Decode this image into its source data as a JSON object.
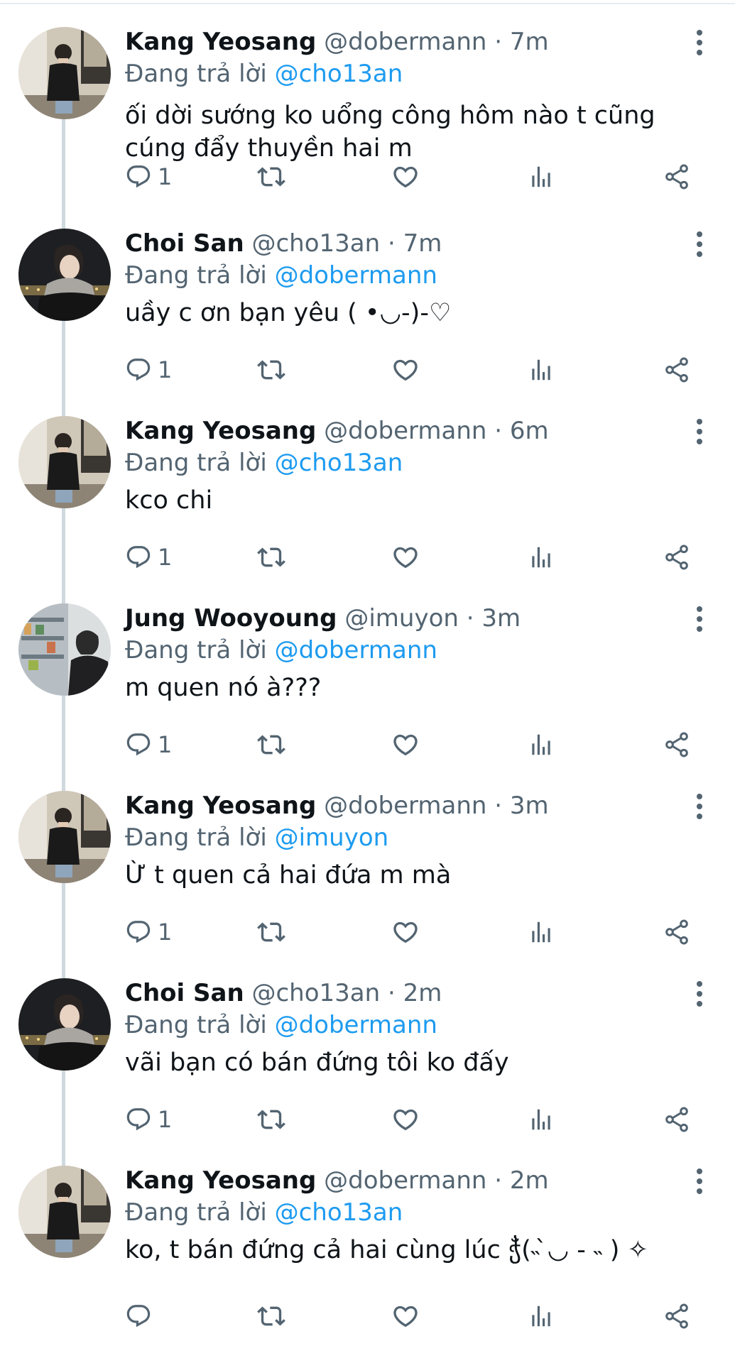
{
  "reply_prefix": "Đang trả lời",
  "colors": {
    "accent": "#1d9bf0",
    "secondary": "#536471",
    "text": "#0f1419",
    "thread_line": "#cfd9de"
  },
  "tweets": [
    {
      "name": "Kang Yeosang",
      "meta": "@dobermann · 7m",
      "reply_to": "@cho13an",
      "text": "ối dời sướng ko uổng công hôm nào t cũng cúng đẩy thuyền hai m",
      "reply_count": "1",
      "avatar": "avatar-yeosang"
    },
    {
      "name": "Choi San",
      "meta": "@cho13an · 7m",
      "reply_to": "@dobermann",
      "text": "uầy c ơn bạn yêu ( •◡-)-♡",
      "reply_count": "1",
      "avatar": "avatar-san"
    },
    {
      "name": "Kang Yeosang",
      "meta": "@dobermann · 6m",
      "reply_to": "@cho13an",
      "text": "kco chi",
      "reply_count": "1",
      "avatar": "avatar-yeosang"
    },
    {
      "name": "Jung Wooyoung",
      "meta": "@imuyon · 3m",
      "reply_to": "@dobermann",
      "text": "m quen nó à???",
      "reply_count": "1",
      "avatar": "avatar-wooyoung"
    },
    {
      "name": "Kang Yeosang",
      "meta": "@dobermann · 3m",
      "reply_to": "@imuyon",
      "text": "Ừ t quen cả hai đứa m mà",
      "reply_count": "1",
      "avatar": "avatar-yeosang"
    },
    {
      "name": "Choi San",
      "meta": "@cho13an · 2m",
      "reply_to": "@dobermann",
      "text": "vãi bạn có bán đứng tôi ko đấy",
      "reply_count": "1",
      "avatar": "avatar-san"
    },
    {
      "name": "Kang Yeosang",
      "meta": "@dobermann · 2m",
      "reply_to": "@cho13an",
      "text": "ko, t bán đứng cả hai cùng lúc ჭ̐(˵ ̀◡ - ˵ ) ✧",
      "reply_count": "",
      "avatar": "avatar-yeosang"
    }
  ]
}
